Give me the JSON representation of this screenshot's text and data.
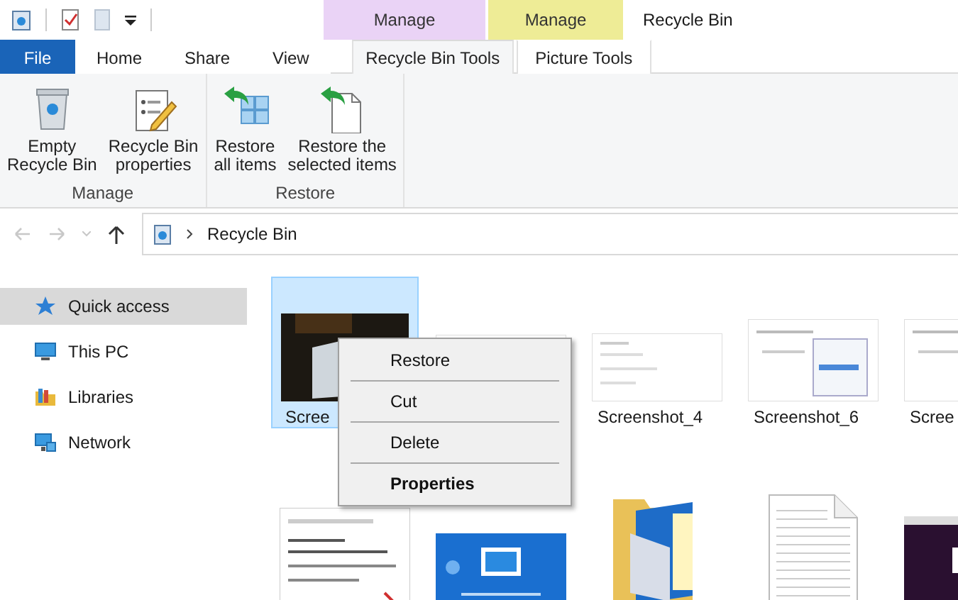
{
  "window": {
    "title": "Recycle Bin"
  },
  "ribbon_tabs": [
    {
      "label": "File",
      "kind": "file",
      "selected": false
    },
    {
      "label": "Home",
      "kind": "plain",
      "selected": false
    },
    {
      "label": "Share",
      "kind": "plain",
      "selected": false
    },
    {
      "label": "View",
      "kind": "plain",
      "selected": false
    },
    {
      "label": "Recycle Bin Tools",
      "kind": "contextual",
      "context": {
        "label": "Manage",
        "color": "#ead3f6"
      },
      "selected": true
    },
    {
      "label": "Picture Tools",
      "kind": "contextual",
      "context": {
        "label": "Manage",
        "color": "#eeec96"
      },
      "selected": false
    }
  ],
  "ribbon_groups": [
    {
      "label": "Manage",
      "buttons": [
        {
          "lines": [
            "Empty",
            "Recycle Bin"
          ],
          "kind": "bin"
        },
        {
          "lines": [
            "Recycle Bin",
            "properties"
          ],
          "kind": "properties"
        }
      ]
    },
    {
      "label": "Restore",
      "buttons": [
        {
          "lines": [
            "Restore",
            "all items"
          ],
          "kind": "restore-all"
        },
        {
          "lines": [
            "Restore the",
            "selected items"
          ],
          "kind": "restore-selected"
        }
      ]
    }
  ],
  "address_bar": {
    "path": "Recycle Bin"
  },
  "navigation": [
    {
      "label": "Quick access",
      "kind": "star",
      "selected": true
    },
    {
      "label": "This PC",
      "kind": "pc",
      "selected": false
    },
    {
      "label": "Libraries",
      "kind": "libraries",
      "selected": false
    },
    {
      "label": "Network",
      "kind": "network",
      "selected": false
    }
  ],
  "files": [
    {
      "label": "Scree",
      "kind": "photo",
      "selected": true
    },
    {
      "kind": "screenshot",
      "selected": false
    },
    {
      "label": "Screenshot_4",
      "kind": "screenshot",
      "selected": false
    },
    {
      "label": "Screenshot_6",
      "kind": "dialog",
      "selected": false
    },
    {
      "label": "Scree",
      "kind": "dialog",
      "selected": false
    },
    {
      "kind": "document-shot",
      "selected": false
    },
    {
      "kind": "banner",
      "selected": false
    },
    {
      "kind": "folder",
      "selected": false
    },
    {
      "kind": "text-file",
      "selected": false
    },
    {
      "kind": "dark-shot",
      "selected": false
    }
  ],
  "context_menu": {
    "items": [
      {
        "label": "Restore",
        "default": false
      },
      {
        "label": "Cut",
        "default": false
      },
      {
        "label": "Delete",
        "default": false
      },
      {
        "label": "Properties",
        "default": true
      }
    ]
  }
}
